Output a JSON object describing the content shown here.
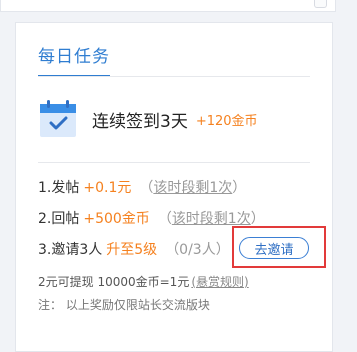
{
  "icons": {
    "calendar": "calendar-check-icon",
    "handle": "collapse-handle-icon"
  },
  "colors": {
    "accent": "#2f7dd1",
    "reward": "#f5811f",
    "highlight": "#e23a3a"
  },
  "card": {
    "title": "每日任务"
  },
  "checkin": {
    "label": "连续签到3天",
    "reward": "+120金币"
  },
  "tasks": [
    {
      "label": "1.发帖",
      "reward": "+0.1元",
      "limit_prefix": "（",
      "limit_link": "该时段剩1次",
      "limit_suffix": "）"
    },
    {
      "label": "2.回帖",
      "reward": "+500金币",
      "limit_prefix": "（",
      "limit_link": "该时段剩1次",
      "limit_suffix": "）"
    },
    {
      "label": "3.邀请3人",
      "reward": "升至5级",
      "progress": "（0/3人）",
      "button": "去邀请"
    }
  ],
  "info": {
    "withdraw_text": "2元可提现 10000金币=1元",
    "rules_link": "(悬赏规则)",
    "note": "注：  以上奖励仅限站长交流版块"
  }
}
